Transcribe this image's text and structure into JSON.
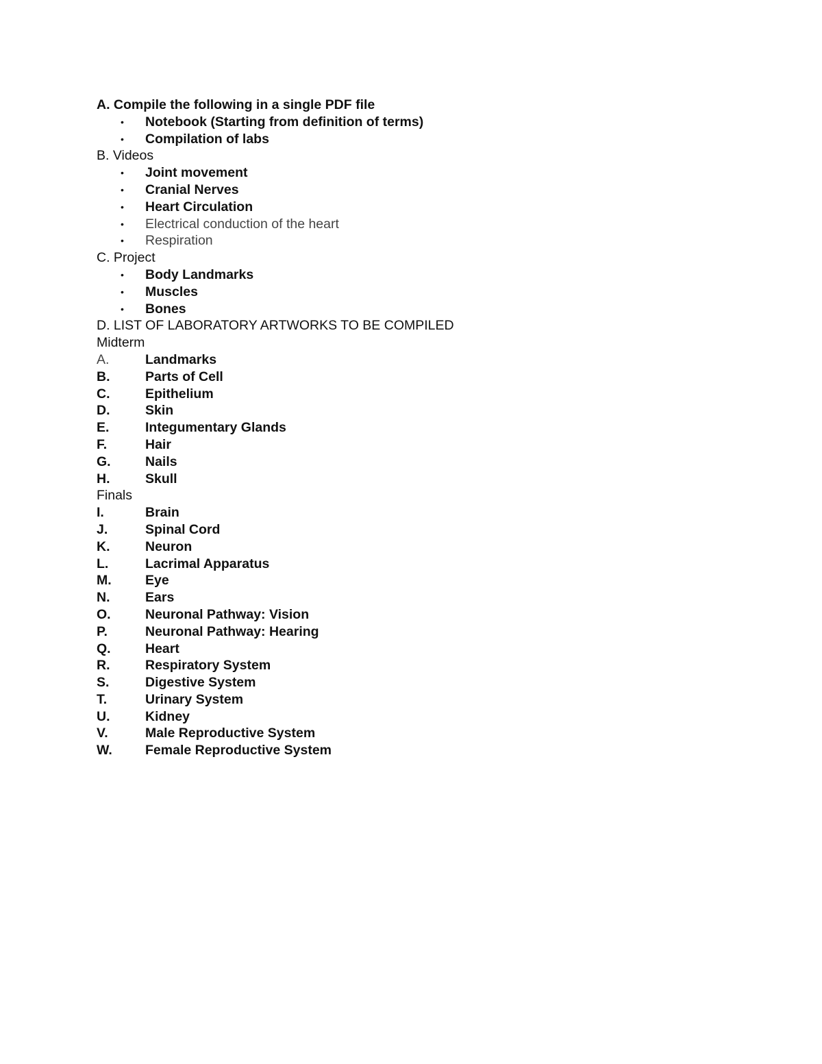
{
  "sections": [
    {
      "title": "A. Compile the following in a single PDF file",
      "items": [
        {
          "text": "Notebook (Starting from definition of terms)",
          "style": "bold"
        },
        {
          "text": "Compilation of labs",
          "style": "bold"
        }
      ]
    },
    {
      "title": "B. Videos",
      "items": [
        {
          "text": "Joint movement",
          "style": "bold"
        },
        {
          "text": "Cranial Nerves",
          "style": "bold"
        },
        {
          "text": "Heart Circulation",
          "style": "bold"
        },
        {
          "text": "Electrical conduction of the heart",
          "style": "light"
        },
        {
          "text": "Respiration",
          "style": "light"
        }
      ]
    },
    {
      "title": "C. Project",
      "items": [
        {
          "text": "Body Landmarks",
          "style": "bold"
        },
        {
          "text": "Muscles",
          "style": "bold"
        },
        {
          "text": "Bones",
          "style": "bold"
        }
      ]
    }
  ],
  "bullet_glyph": "•",
  "lab_list": {
    "title": "D. LIST OF LABORATORY ARTWORKS TO BE COMPILED",
    "groups": [
      {
        "label": "Midterm",
        "items": [
          {
            "marker": "A.",
            "text": "Landmarks"
          },
          {
            "marker": "B.",
            "text": "Parts of Cell"
          },
          {
            "marker": "C.",
            "text": "Epithelium"
          },
          {
            "marker": "D.",
            "text": "Skin"
          },
          {
            "marker": "E.",
            "text": "Integumentary Glands"
          },
          {
            "marker": "F.",
            "text": "Hair"
          },
          {
            "marker": "G.",
            "text": "Nails"
          },
          {
            "marker": "H.",
            "text": "Skull"
          }
        ]
      },
      {
        "label": "Finals",
        "items": [
          {
            "marker": "I.",
            "text": "Brain"
          },
          {
            "marker": "J.",
            "text": "Spinal Cord"
          },
          {
            "marker": "K.",
            "text": "Neuron"
          },
          {
            "marker": "L.",
            "text": "Lacrimal Apparatus"
          },
          {
            "marker": "M.",
            "text": "Eye"
          },
          {
            "marker": "N.",
            "text": "Ears"
          },
          {
            "marker": "O.",
            "text": "Neuronal Pathway: Vision"
          },
          {
            "marker": "P.",
            "text": "Neuronal Pathway: Hearing"
          },
          {
            "marker": "Q.",
            "text": "Heart"
          },
          {
            "marker": "R.",
            "text": "Respiratory System"
          },
          {
            "marker": "S.",
            "text": "Digestive System"
          },
          {
            "marker": "T.",
            "text": "Urinary System"
          },
          {
            "marker": "U.",
            "text": "Kidney"
          },
          {
            "marker": "V.",
            "text": "Male Reproductive System"
          },
          {
            "marker": "W.",
            "text": "Female Reproductive System"
          }
        ]
      }
    ]
  }
}
